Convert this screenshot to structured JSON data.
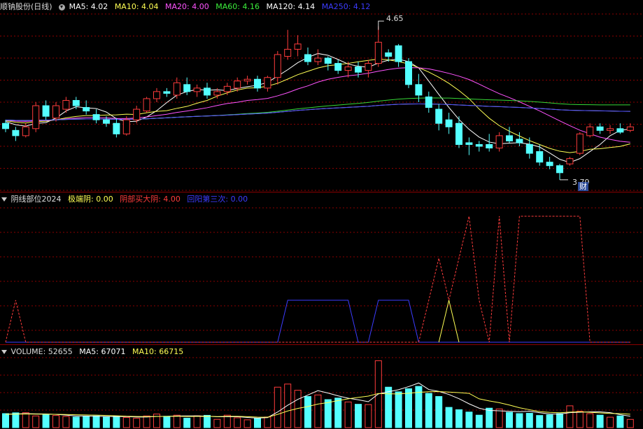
{
  "colors": {
    "up": "#ff3c3c",
    "down": "#54ffff",
    "ma5": "#ffffff",
    "ma10": "#ffff54",
    "ma20": "#ff54ff",
    "ma60": "#3cf03c",
    "ma120": "#ffffff",
    "ma250": "#3c3cff",
    "grid": "#8b0000",
    "vol_ma5": "#ffffff",
    "vol_ma10": "#ffff54"
  },
  "price_pane": {
    "title": "顺钠股份(日线)",
    "ma5": "MA5: 4.02",
    "ma10": "MA10: 4.04",
    "ma20": "MA20: 4.00",
    "ma60": "MA60: 4.16",
    "ma120": "MA120: 4.14",
    "ma250": "MA250: 4.12",
    "high_label": "4.65",
    "low_label": "3.79",
    "cai_badge": "财"
  },
  "indicator_pane": {
    "title": "阴线部位2024",
    "item1": "极端阴: 0.00",
    "item2": "阴部买大阴: 4.00",
    "item3": "回阳第三次: 0.00"
  },
  "volume_pane": {
    "volume": "VOLUME: 52655",
    "ma5": "MA5: 67071",
    "ma10": "MA10: 66715"
  },
  "chart_data": {
    "type": "candlestick",
    "ylim": [
      3.72,
      4.72
    ],
    "candles": [
      [
        4.1,
        4.12,
        4.05,
        4.07
      ],
      [
        4.06,
        4.08,
        4.0,
        4.03
      ],
      [
        4.03,
        4.1,
        4.02,
        4.08
      ],
      [
        4.07,
        4.22,
        4.05,
        4.2
      ],
      [
        4.2,
        4.23,
        4.12,
        4.14
      ],
      [
        4.13,
        4.22,
        4.11,
        4.2
      ],
      [
        4.18,
        4.25,
        4.16,
        4.23
      ],
      [
        4.23,
        4.25,
        4.18,
        4.2
      ],
      [
        4.19,
        4.23,
        4.15,
        4.17
      ],
      [
        4.15,
        4.18,
        4.1,
        4.12
      ],
      [
        4.12,
        4.14,
        4.08,
        4.1
      ],
      [
        4.1,
        4.13,
        4.02,
        4.04
      ],
      [
        4.04,
        4.14,
        4.03,
        4.12
      ],
      [
        4.12,
        4.2,
        4.1,
        4.18
      ],
      [
        4.17,
        4.25,
        4.16,
        4.24
      ],
      [
        4.24,
        4.3,
        4.22,
        4.28
      ],
      [
        4.28,
        4.3,
        4.25,
        4.27
      ],
      [
        4.26,
        4.36,
        4.24,
        4.33
      ],
      [
        4.32,
        4.36,
        4.26,
        4.28
      ],
      [
        4.28,
        4.32,
        4.25,
        4.3
      ],
      [
        4.3,
        4.33,
        4.24,
        4.26
      ],
      [
        4.26,
        4.3,
        4.24,
        4.28
      ],
      [
        4.28,
        4.33,
        4.26,
        4.31
      ],
      [
        4.3,
        4.36,
        4.28,
        4.34
      ],
      [
        4.34,
        4.37,
        4.32,
        4.35
      ],
      [
        4.35,
        4.37,
        4.28,
        4.3
      ],
      [
        4.3,
        4.37,
        4.28,
        4.36
      ],
      [
        4.36,
        4.51,
        4.32,
        4.49
      ],
      [
        4.48,
        4.63,
        4.46,
        4.52
      ],
      [
        4.52,
        4.6,
        4.48,
        4.55
      ],
      [
        4.49,
        4.53,
        4.43,
        4.45
      ],
      [
        4.45,
        4.52,
        4.43,
        4.47
      ],
      [
        4.47,
        4.48,
        4.4,
        4.44
      ],
      [
        4.44,
        4.46,
        4.38,
        4.4
      ],
      [
        4.4,
        4.45,
        4.36,
        4.42
      ],
      [
        4.42,
        4.45,
        4.36,
        4.39
      ],
      [
        4.4,
        4.46,
        4.36,
        4.44
      ],
      [
        4.44,
        4.65,
        4.42,
        4.56
      ],
      [
        4.5,
        4.52,
        4.45,
        4.48
      ],
      [
        4.54,
        4.55,
        4.42,
        4.45
      ],
      [
        4.45,
        4.47,
        4.3,
        4.32
      ],
      [
        4.32,
        4.38,
        4.22,
        4.26
      ],
      [
        4.25,
        4.28,
        4.16,
        4.19
      ],
      [
        4.18,
        4.21,
        4.06,
        4.1
      ],
      [
        4.12,
        4.16,
        4.04,
        4.08
      ],
      [
        4.1,
        4.14,
        3.96,
        3.98
      ],
      [
        3.99,
        4.02,
        3.92,
        3.98
      ],
      [
        3.98,
        4.0,
        3.94,
        3.97
      ],
      [
        3.98,
        4.04,
        3.94,
        3.96
      ],
      [
        3.96,
        4.05,
        3.94,
        4.03
      ],
      [
        4.03,
        4.08,
        3.99,
        4.0
      ],
      [
        4.01,
        4.05,
        3.97,
        3.99
      ],
      [
        3.98,
        4.02,
        3.9,
        3.93
      ],
      [
        3.94,
        3.98,
        3.86,
        3.88
      ],
      [
        3.88,
        3.91,
        3.84,
        3.86
      ],
      [
        3.86,
        3.87,
        3.78,
        3.82
      ],
      [
        3.87,
        3.91,
        3.86,
        3.9
      ],
      [
        3.93,
        4.05,
        3.92,
        4.04
      ],
      [
        4.03,
        4.1,
        4.02,
        4.08
      ],
      [
        4.08,
        4.1,
        4.04,
        4.06
      ],
      [
        4.06,
        4.09,
        4.04,
        4.07
      ],
      [
        4.07,
        4.1,
        4.04,
        4.05
      ],
      [
        4.06,
        4.1,
        4.05,
        4.08
      ]
    ],
    "volume": [
      9000,
      9500,
      9600,
      7500,
      8200,
      7800,
      7200,
      6800,
      7400,
      7500,
      6900,
      7200,
      6500,
      6000,
      7500,
      8700,
      7300,
      8000,
      6100,
      7600,
      7900,
      5300,
      8000,
      6300,
      5000,
      6000,
      6800,
      26000,
      28000,
      24000,
      20000,
      21000,
      18000,
      19000,
      16500,
      15000,
      14800,
      43000,
      26000,
      23000,
      25000,
      26500,
      22000,
      20000,
      13000,
      11500,
      10000,
      8000,
      12500,
      12000,
      9800,
      9000,
      9200,
      7800,
      8200,
      9000,
      14000,
      10500,
      9000,
      8000,
      6700,
      7500,
      5265
    ],
    "ind_dash": [
      [
        0,
        0.0
      ],
      [
        1,
        1.0
      ],
      [
        2,
        0.0
      ],
      [
        39,
        0.0
      ],
      [
        41,
        0.0
      ],
      [
        43,
        2.0
      ],
      [
        44,
        1.0
      ],
      [
        46,
        3.0
      ],
      [
        47,
        1.0
      ],
      [
        48,
        0.0
      ],
      [
        49,
        3.0
      ],
      [
        50,
        0.0
      ],
      [
        51,
        3.0
      ],
      [
        53,
        3.0
      ],
      [
        55,
        3.0
      ],
      [
        57,
        3.0
      ],
      [
        58,
        0.0
      ],
      [
        62,
        0.0
      ]
    ],
    "ind_yellow": [
      [
        43,
        0.0
      ],
      [
        44,
        1.0
      ],
      [
        45,
        0.0
      ]
    ],
    "ind_blue": [
      [
        0,
        0.0
      ],
      [
        27,
        0.0
      ],
      [
        28,
        1.0
      ],
      [
        34,
        1.0
      ],
      [
        35,
        0.0
      ],
      [
        36,
        0.0
      ],
      [
        37,
        1.0
      ],
      [
        40,
        1.0
      ],
      [
        41,
        0.0
      ],
      [
        62,
        0.0
      ]
    ]
  }
}
